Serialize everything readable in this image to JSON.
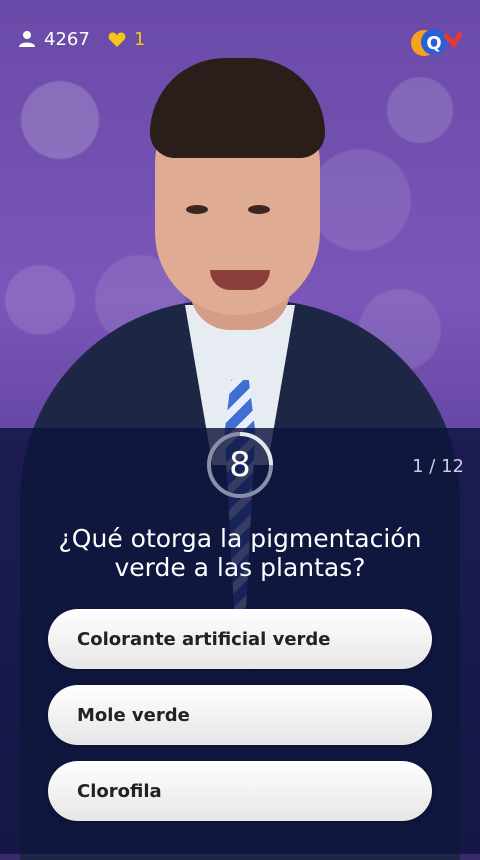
{
  "topbar": {
    "players_count": "4267",
    "lives_count": "1",
    "player_icon": "person-icon",
    "life_icon": "heart-icon",
    "heart_color": "#f5c518"
  },
  "quiz": {
    "timer_value": "8",
    "progress": "1 / 12",
    "question": "¿Qué otorga la pigmentación verde a las plantas?",
    "answers": [
      "Colorante artificial verde",
      "Mole verde",
      "Clorofila"
    ]
  },
  "brand": {
    "accent_blue": "#2b5fd9",
    "accent_orange": "#f7a21b",
    "accent_red": "#e53935"
  }
}
